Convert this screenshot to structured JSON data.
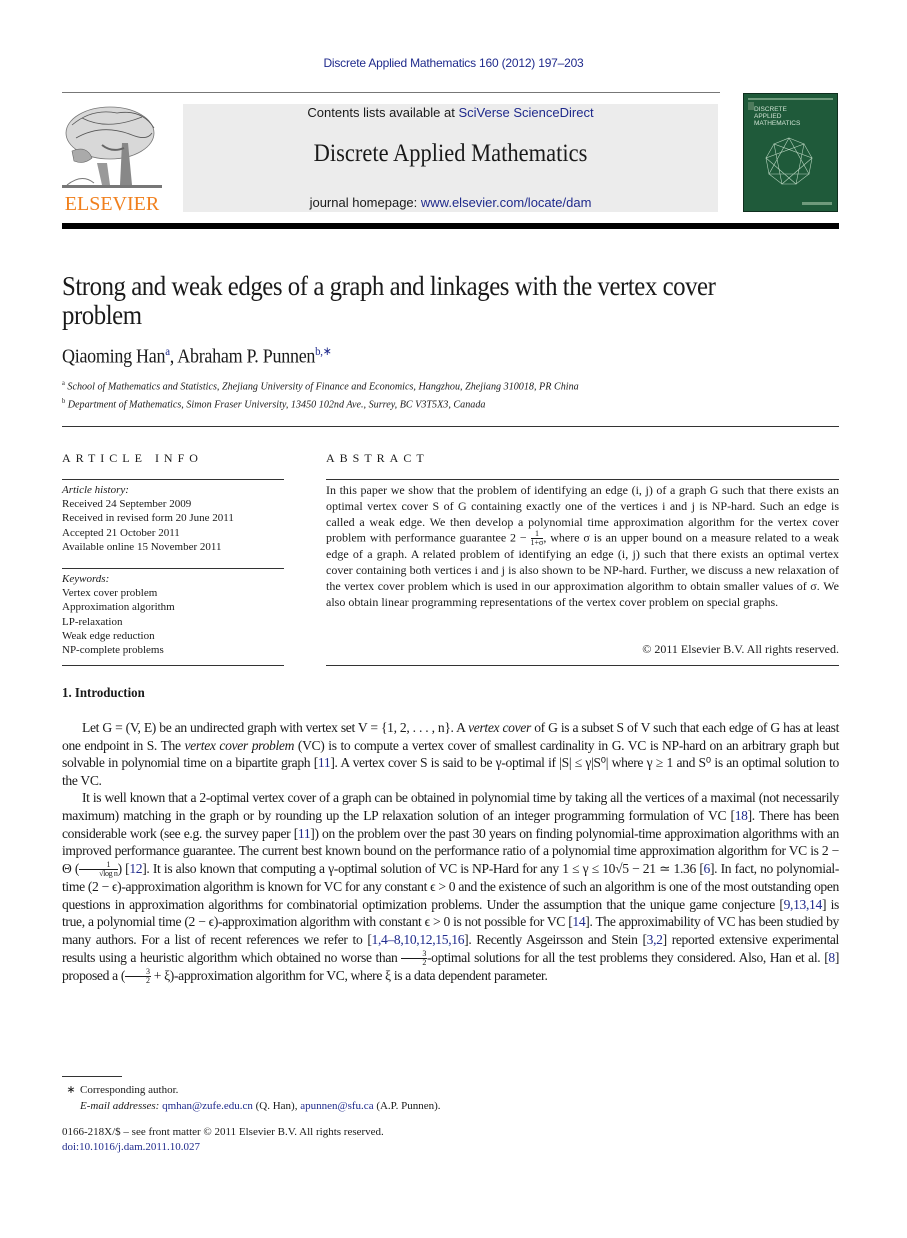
{
  "running_head": "Discrete Applied Mathematics 160 (2012) 197–203",
  "header": {
    "publisher_logo_text": "ELSEVIER",
    "contents_prefix": "Contents lists available at ",
    "contents_link": "SciVerse ScienceDirect",
    "journal_title": "Discrete Applied Mathematics",
    "homepage_prefix": "journal homepage: ",
    "homepage_link": "www.elsevier.com/locate/dam",
    "cover_lines": [
      "DISCRETE",
      "APPLIED",
      "MATHEMATICS"
    ]
  },
  "article": {
    "title": "Strong and weak edges of a graph and linkages with the vertex cover problem",
    "authors": [
      {
        "name": "Qiaoming Han",
        "sup": "a"
      },
      {
        "name": "Abraham P. Punnen",
        "sup": "b,∗"
      }
    ],
    "affiliations": [
      {
        "sup": "a",
        "text": "School of Mathematics and Statistics, Zhejiang University of Finance and Economics, Hangzhou, Zhejiang 310018, PR China"
      },
      {
        "sup": "b",
        "text": "Department of Mathematics, Simon Fraser University, 13450 102nd Ave., Surrey, BC V3T5X3, Canada"
      }
    ]
  },
  "article_info": {
    "heading": "ARTICLE INFO",
    "history_label": "Article history:",
    "history": [
      "Received 24 September 2009",
      "Received in revised form 20 June 2011",
      "Accepted 21 October 2011",
      "Available online 15 November 2011"
    ],
    "keywords_label": "Keywords:",
    "keywords": [
      "Vertex cover problem",
      "Approximation algorithm",
      "LP-relaxation",
      "Weak edge reduction",
      "NP-complete problems"
    ]
  },
  "abstract": {
    "heading": "ABSTRACT",
    "part1": "In this paper we show that the problem of identifying an edge (i, j) of a graph G such that there exists an optimal vertex cover S of G containing exactly one of the vertices i and j is NP-hard. Such an edge is called a weak edge. We then develop a polynomial time approximation algorithm for the vertex cover problem with performance guarantee 2 − ",
    "frac_num": "1",
    "frac_den": "1+σ",
    "part2": ", where σ is an upper bound on a measure related to a weak edge of a graph. A related problem of identifying an edge (i, j) such that there exists an optimal vertex cover containing both vertices i and j is also shown to be NP-hard. Further, we discuss a new relaxation of the vertex cover problem which is used in our approximation algorithm to obtain smaller values of σ. We also obtain linear programming representations of the vertex cover problem on special graphs.",
    "copyright": "© 2011 Elsevier B.V. All rights reserved."
  },
  "introduction": {
    "heading": "1. Introduction",
    "p1": {
      "a": "Let G = (V, E) be an undirected graph with vertex set V = {1, 2, . . . , n}. A ",
      "em1": "vertex cover",
      "b": " of G is a subset S of V such that each edge of G has at least one endpoint in S. The ",
      "em2": "vertex cover problem",
      "c": " (VC) is to compute a vertex cover of smallest cardinality in G. VC is NP-hard on an arbitrary graph but solvable in polynomial time on a bipartite graph [",
      "ref1": "11",
      "d": "]. A vertex cover S is said to be γ-optimal if |S| ≤ γ|S⁰| where γ ≥ 1 and S⁰ is an optimal solution to the VC."
    },
    "p2": {
      "a": "It is well known that a 2-optimal vertex cover of a graph can be obtained in polynomial time by taking all the vertices of a maximal (not necessarily maximum) matching in the graph or by rounding up the LP relaxation solution of an integer programming formulation of VC [",
      "ref_18": "18",
      "b": "]. There has been considerable work (see e.g. the survey paper [",
      "ref_11": "11",
      "c": "]) on the problem over the past 30 years on finding polynomial-time approximation algorithms with an improved performance guarantee. The current best known bound on the performance ratio of a polynomial time approximation algorithm for VC is 2 − Θ (",
      "theta_num": "1",
      "theta_den": "√log n",
      "d": ") [",
      "ref_12": "12",
      "e": "]. It is also known that computing a γ-optimal solution of VC is NP-Hard for any 1 ≤ γ ≤ 10√5 − 21 ≃ 1.36 [",
      "ref_6": "6",
      "f": "]. In fact, no polynomial-time (2 − ϵ)-approximation algorithm is known for VC for any constant ϵ > 0 and the existence of such an algorithm is one of the most outstanding open questions in approximation algorithms for combinatorial optimization problems. Under the assumption that the unique game conjecture [",
      "ref_9_13_14": "9,13,14",
      "g": "] is true, a polynomial time (2 − ϵ)-approximation algorithm with constant ϵ > 0 is not possible for VC [",
      "ref_14": "14",
      "h": "]. The approximability of VC has been studied by many authors. For a list of recent references we refer to [",
      "ref_list": "1,4–8,10,12,15,16",
      "i": "]. Recently Asgeirsson and Stein [",
      "ref_3_2": "3,2",
      "j": "] reported extensive experimental results using a heuristic algorithm which obtained no worse than ",
      "three_halves_num": "3",
      "three_halves_den": "2",
      "k": "-optimal solutions for all the test problems they considered. Also, Han et al. [",
      "ref_8": "8",
      "l": "] proposed a (",
      "m": " + ξ)-approximation algorithm for VC, where ξ is a data dependent parameter."
    }
  },
  "footnotes": {
    "star": "∗",
    "corresponding": "Corresponding author.",
    "email_label": "E-mail addresses: ",
    "email1": "qmhan@zufe.edu.cn",
    "email1_owner": " (Q. Han), ",
    "email2": "apunnen@sfu.ca",
    "email2_owner": " (A.P. Punnen)."
  },
  "footer": {
    "issn": "0166-218X/$ – see front matter © 2011 Elsevier B.V. All rights reserved.",
    "doi": "doi:10.1016/j.dam.2011.10.027"
  },
  "colors": {
    "link": "#1f2a8c",
    "elsevier_orange": "#f07f1c",
    "banner_bg": "#ececec",
    "cover_green": "#1f5a3a"
  }
}
